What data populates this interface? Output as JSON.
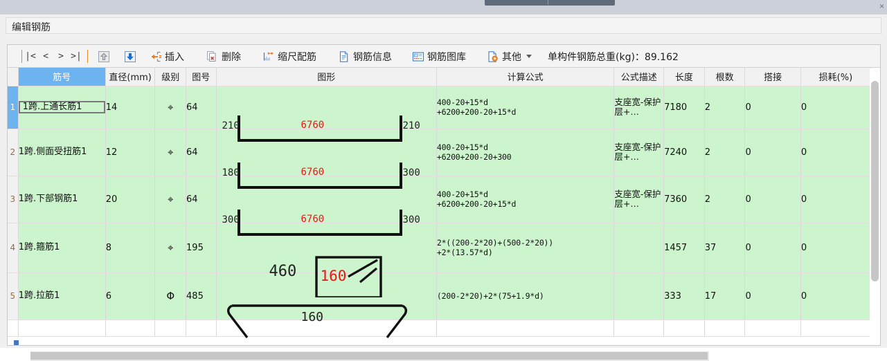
{
  "window": {
    "panel_title": "编辑钢筋"
  },
  "toolbar": {
    "nav": [
      {
        "name": "first-record",
        "label": "|<"
      },
      {
        "name": "prev-record",
        "label": "<"
      },
      {
        "name": "next-record",
        "label": ">"
      },
      {
        "name": "last-record",
        "label": ">|"
      }
    ],
    "buttons": [
      {
        "name": "move-up",
        "icon": "arrow-up-box-icon",
        "label": ""
      },
      {
        "name": "move-down",
        "icon": "arrow-down-box-icon",
        "label": ""
      },
      {
        "name": "insert",
        "icon": "insert-row-icon",
        "label": "插入"
      },
      {
        "name": "delete",
        "icon": "delete-page-icon",
        "label": "删除"
      },
      {
        "name": "scaled-rebar",
        "icon": "scale-rebar-icon",
        "label": "缩尺配筋"
      },
      {
        "name": "rebar-info",
        "icon": "document-icon",
        "label": "钢筋信息"
      },
      {
        "name": "rebar-library",
        "icon": "library-icon",
        "label": "钢筋图库"
      },
      {
        "name": "other",
        "icon": "gear-page-icon",
        "label": "其他",
        "has_caret": true
      }
    ],
    "total_label": "单构件钢筋总重(kg)：",
    "total_value": "89.162"
  },
  "grid": {
    "columns": [
      {
        "name": "col-rebar-no",
        "label": "筋号",
        "selected": true
      },
      {
        "name": "col-diameter",
        "label": "直径(mm)"
      },
      {
        "name": "col-grade",
        "label": "级别"
      },
      {
        "name": "col-figure-no",
        "label": "图号"
      },
      {
        "name": "col-shape",
        "label": "图形"
      },
      {
        "name": "col-formula",
        "label": "计算公式"
      },
      {
        "name": "col-formula-desc",
        "label": "公式描述"
      },
      {
        "name": "col-length",
        "label": "长度"
      },
      {
        "name": "col-count",
        "label": "根数"
      },
      {
        "name": "col-lap",
        "label": "搭接"
      },
      {
        "name": "col-loss",
        "label": "损耗(%)"
      }
    ],
    "rows": [
      {
        "index": "1",
        "current": true,
        "editing": true,
        "rebar_no": "1跨.上通长筋1",
        "diameter": "14",
        "grade": "⌖",
        "figure_no": "64",
        "shape_type": "u-bar",
        "shape_left": "210",
        "shape_mid": "6760",
        "shape_right": "210",
        "formula": "400-20+15*d\n+6200+200-20+15*d",
        "formula_desc": "支座宽-保护层+…",
        "length": "7180",
        "count": "2",
        "lap": "0",
        "loss": "0"
      },
      {
        "index": "2",
        "current": false,
        "editing": false,
        "rebar_no": "1跨.侧面受扭筋1",
        "diameter": "12",
        "grade": "⌖",
        "figure_no": "64",
        "shape_type": "u-bar",
        "shape_left": "180",
        "shape_mid": "6760",
        "shape_right": "300",
        "formula": "400-20+15*d\n+6200+200-20+300",
        "formula_desc": "支座宽-保护层+…",
        "length": "7240",
        "count": "2",
        "lap": "0",
        "loss": "0"
      },
      {
        "index": "3",
        "current": false,
        "editing": false,
        "rebar_no": "1跨.下部钢筋1",
        "diameter": "20",
        "grade": "⌖",
        "figure_no": "64",
        "shape_type": "u-bar",
        "shape_left": "300",
        "shape_mid": "6760",
        "shape_right": "300",
        "formula": "400-20+15*d\n+6200+200-20+15*d",
        "formula_desc": "支座宽-保护层+…",
        "length": "7360",
        "count": "2",
        "lap": "0",
        "loss": "0"
      },
      {
        "index": "4",
        "current": false,
        "editing": false,
        "rebar_no": "1跨.箍筋1",
        "diameter": "8",
        "grade": "⌖",
        "figure_no": "195",
        "shape_type": "stirrup",
        "shape_left": "460",
        "shape_mid": "160",
        "shape_right": "",
        "formula": "2*((200-2*20)+(500-2*20))\n+2*(13.57*d)",
        "formula_desc": "",
        "length": "1457",
        "count": "37",
        "lap": "0",
        "loss": "0"
      },
      {
        "index": "5",
        "current": false,
        "editing": false,
        "rebar_no": "1跨.拉筋1",
        "diameter": "6",
        "grade": "Φ",
        "figure_no": "485",
        "shape_type": "tie-bar",
        "shape_left": "",
        "shape_mid": "160",
        "shape_right": "",
        "formula": "(200-2*20)+2*(75+1.9*d)",
        "formula_desc": "",
        "length": "333",
        "count": "17",
        "lap": "0",
        "loss": "0"
      }
    ]
  }
}
